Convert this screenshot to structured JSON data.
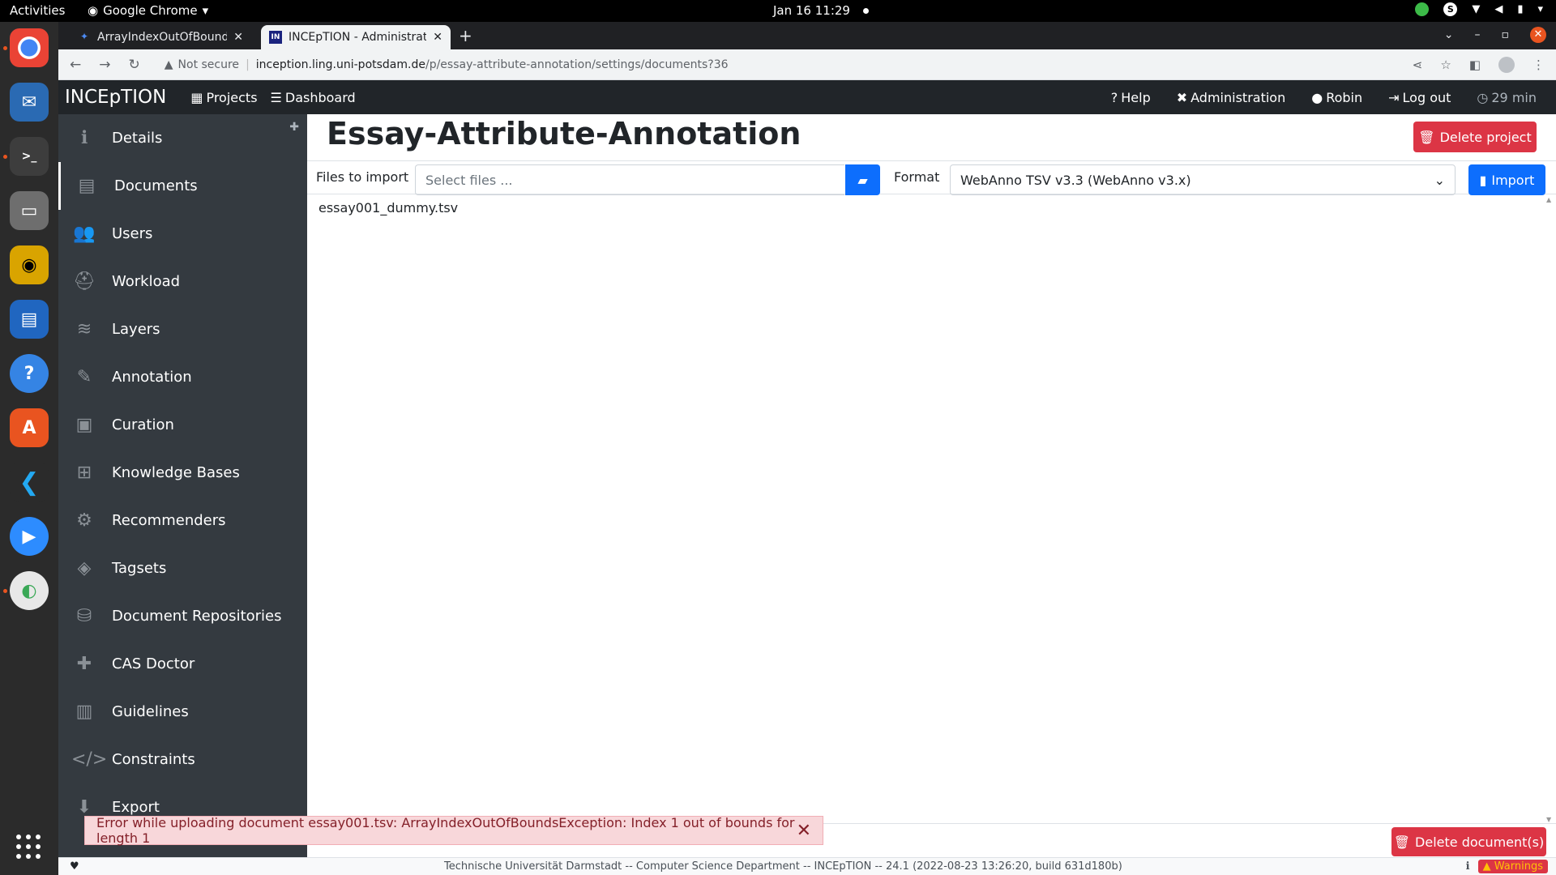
{
  "os": {
    "activities": "Activities",
    "app_name": "Google Chrome",
    "clock": "Jan 16  11:29"
  },
  "browser": {
    "tabs": [
      {
        "title": "ArrayIndexOutOfBounds",
        "active": false
      },
      {
        "title": "INCEpTION - Administrati",
        "active": true
      }
    ],
    "security_label": "Not secure",
    "url_host": "inception.ling.uni-potsdam.de",
    "url_path": "/p/essay-attribute-annotation/settings/documents?36"
  },
  "navbar": {
    "brand": "INCEpTION",
    "projects": "Projects",
    "dashboard": "Dashboard",
    "help": "Help",
    "administration": "Administration",
    "user": "Robin",
    "logout": "Log out",
    "timer": "29 min"
  },
  "sidebar": {
    "items": [
      {
        "label": "Details",
        "icon": "info-icon"
      },
      {
        "label": "Documents",
        "icon": "file-icon"
      },
      {
        "label": "Users",
        "icon": "users-icon"
      },
      {
        "label": "Workload",
        "icon": "hard-hat-icon"
      },
      {
        "label": "Layers",
        "icon": "layers-icon"
      },
      {
        "label": "Annotation",
        "icon": "highlighter-icon"
      },
      {
        "label": "Curation",
        "icon": "clipboard-icon"
      },
      {
        "label": "Knowledge Bases",
        "icon": "sitemap-icon"
      },
      {
        "label": "Recommenders",
        "icon": "robot-icon"
      },
      {
        "label": "Tagsets",
        "icon": "tags-icon"
      },
      {
        "label": "Document Repositories",
        "icon": "database-icon"
      },
      {
        "label": "CAS Doctor",
        "icon": "medkit-icon"
      },
      {
        "label": "Guidelines",
        "icon": "book-icon"
      },
      {
        "label": "Constraints",
        "icon": "code-icon"
      },
      {
        "label": "Export",
        "icon": "download-icon"
      }
    ]
  },
  "main": {
    "title": "Essay-Attribute-Annotation",
    "delete_project": "Delete project",
    "files_to_import_label": "Files to import",
    "file_placeholder": "Select files ...",
    "format_label": "Format",
    "format_value": "WebAnno TSV v3.3 (WebAnno v3.x)",
    "import_button": "Import",
    "documents": [
      "essay001_dummy.tsv"
    ],
    "delete_documents": "Delete document(s)"
  },
  "toast": {
    "message": "Error while uploading document essay001.tsv: ArrayIndexOutOfBoundsException: Index 1 out of bounds for length 1"
  },
  "footer": {
    "text": "Technische Universität Darmstadt -- Computer Science Department -- INCEpTION -- 24.1 (2022-08-23 13:26:20, build 631d180b)",
    "warnings": "Warnings"
  },
  "colors": {
    "navbar": "#212529",
    "sidebar": "#343a40",
    "danger": "#dc3545",
    "primary": "#0d6efd"
  }
}
